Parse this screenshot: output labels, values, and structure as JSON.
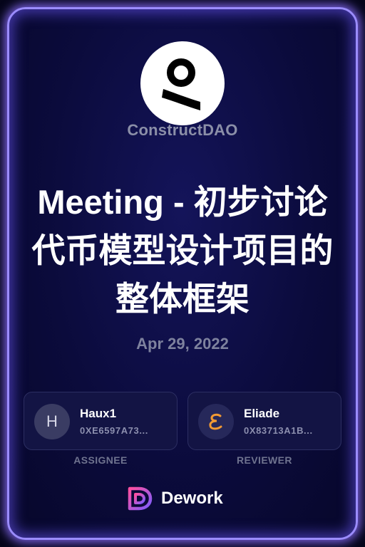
{
  "organization": {
    "name": "ConstructDAO",
    "logo_icon": "constructdao-logo-icon"
  },
  "task": {
    "title": "Meeting - 初步讨论代币模型设计项目的整体框架",
    "date": "Apr 29, 2022"
  },
  "assignee": {
    "avatar_letter": "H",
    "name": "Haux1",
    "address": "0XE6597A73...",
    "role_label": "ASSIGNEE"
  },
  "reviewer": {
    "avatar_icon": "script-e-icon",
    "name": "Eliade",
    "address": "0X83713A1B...",
    "role_label": "REVIEWER"
  },
  "footer": {
    "brand_name": "Dework",
    "brand_icon": "dework-logo-icon"
  },
  "colors": {
    "border_glow": "#9b8cff",
    "background": "#0b0b3c",
    "muted_text": "#8b8fa8",
    "brand_gradient_start": "#ff4fa0",
    "brand_gradient_end": "#7a5cff"
  }
}
